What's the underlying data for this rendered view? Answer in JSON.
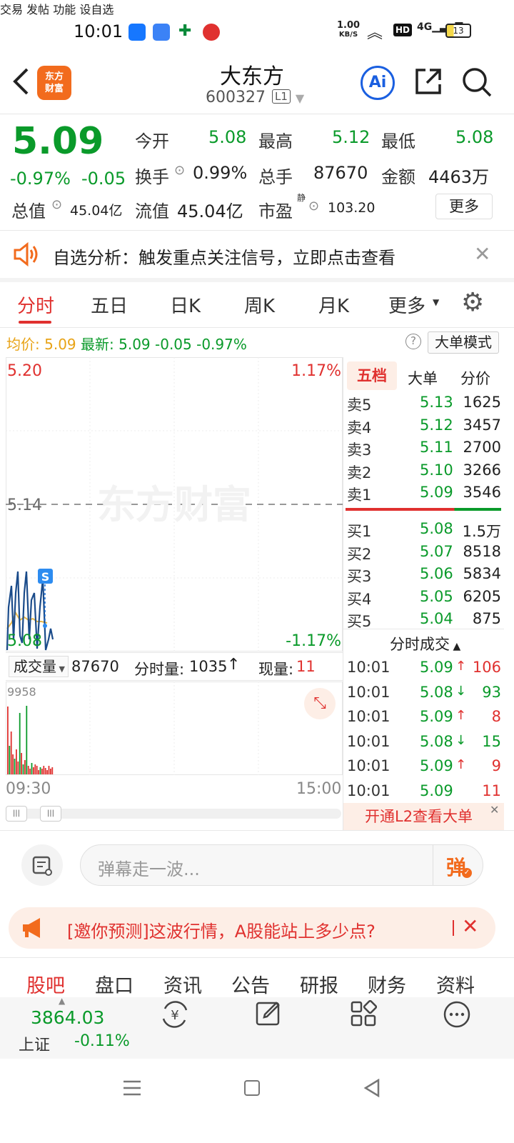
{
  "status": {
    "time": "10:01",
    "net_speed": "1.00",
    "net_unit": "KB/S",
    "hd": "HD",
    "signal": "4G",
    "battery": "13"
  },
  "header": {
    "logo_line1": "东方",
    "logo_line2": "财富",
    "name": "大东方",
    "code": "600327",
    "level": "L1"
  },
  "quote": {
    "price": "5.09",
    "change_pct": "-0.97%",
    "change": "-0.05",
    "open_label": "今开",
    "open": "5.08",
    "high_label": "最高",
    "high": "5.12",
    "low_label": "最低",
    "low": "5.08",
    "turnover_label": "换手",
    "turnover": "0.99%",
    "volume_label": "总手",
    "volume": "87670",
    "amount_label": "金额",
    "amount": "4463万",
    "mktcap_label": "总值",
    "mktcap": "45.04亿",
    "float_label": "流值",
    "float": "45.04亿",
    "pe_label": "市盈",
    "pe_tag": "静",
    "pe": "103.20",
    "more": "更多"
  },
  "notice": {
    "text": "自选分析：触发重点关注信号，立即点击查看"
  },
  "tabs": [
    "分时",
    "五日",
    "日K",
    "周K",
    "月K",
    "更多"
  ],
  "chart_info": {
    "avg_label": "均价:",
    "avg": "5.09",
    "latest_label": "最新:",
    "latest": "5.09",
    "chg": "-0.05",
    "pct": "-0.97%",
    "big_order": "大单模式"
  },
  "chart": {
    "top_price": "5.20",
    "top_pct": "1.17%",
    "mid_price": "5.14",
    "bot_price": "5.08",
    "bot_pct": "-1.17%",
    "watermark": "东方财富",
    "marker": "S"
  },
  "volume_bar": {
    "label": "成交量",
    "total": "87670",
    "minute_label": "分时量:",
    "minute": "1035",
    "now_label": "现量:",
    "now": "11",
    "vmax": "9958",
    "t_start": "09:30",
    "t_end": "15:00"
  },
  "book": {
    "tabs": [
      "五档",
      "大单",
      "分价"
    ],
    "asks": [
      {
        "l": "卖5",
        "p": "5.13",
        "v": "1625"
      },
      {
        "l": "卖4",
        "p": "5.12",
        "v": "3457"
      },
      {
        "l": "卖3",
        "p": "5.11",
        "v": "2700"
      },
      {
        "l": "卖2",
        "p": "5.10",
        "v": "3266"
      },
      {
        "l": "卖1",
        "p": "5.09",
        "v": "3546"
      }
    ],
    "bids": [
      {
        "l": "买1",
        "p": "5.08",
        "v": "1.5万"
      },
      {
        "l": "买2",
        "p": "5.07",
        "v": "8518"
      },
      {
        "l": "买3",
        "p": "5.06",
        "v": "5834"
      },
      {
        "l": "买4",
        "p": "5.05",
        "v": "6205"
      },
      {
        "l": "买5",
        "p": "5.04",
        "v": "875"
      }
    ],
    "ticks_title": "分时成交",
    "ticks": [
      {
        "t": "10:01",
        "p": "5.09",
        "a": "↑",
        "v": "106",
        "c": "red"
      },
      {
        "t": "10:01",
        "p": "5.08",
        "a": "↓",
        "v": "93",
        "c": "green"
      },
      {
        "t": "10:01",
        "p": "5.09",
        "a": "↑",
        "v": "8",
        "c": "red"
      },
      {
        "t": "10:01",
        "p": "5.08",
        "a": "↓",
        "v": "15",
        "c": "green"
      },
      {
        "t": "10:01",
        "p": "5.09",
        "a": "↑",
        "v": "9",
        "c": "red"
      },
      {
        "t": "10:01",
        "p": "5.09",
        "a": "",
        "v": "11",
        "c": "red"
      }
    ],
    "l2": "开通L2查看大单"
  },
  "danmu": {
    "placeholder": "弹幕走一波...",
    "btn": "弹"
  },
  "promo": {
    "text": "[邀你预测]这波行情，A股能站上多少点?"
  },
  "nav": [
    "股吧",
    "盘口",
    "资讯",
    "公告",
    "研报",
    "财务",
    "资料"
  ],
  "bottom": {
    "index_value": "3864.03",
    "index_name": "上证",
    "index_pct": "-0.11%",
    "items": [
      "交易",
      "发帖",
      "功能",
      "设自选"
    ]
  },
  "colors": {
    "up": "#e0312f",
    "down": "#0a9a2a",
    "accent": "#f26b1d"
  }
}
